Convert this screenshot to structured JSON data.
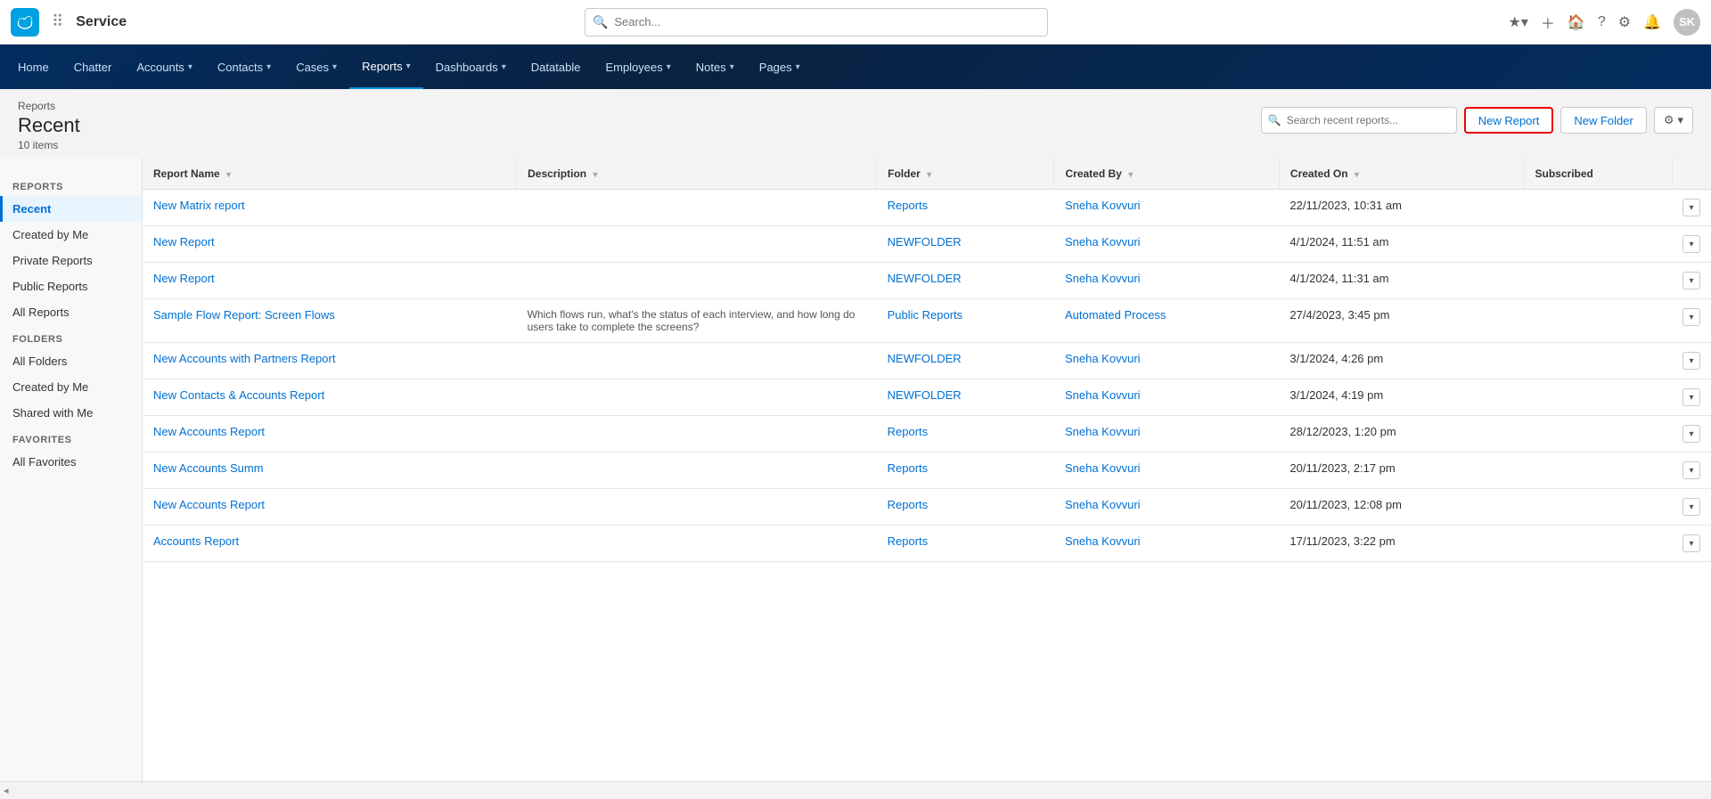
{
  "topNav": {
    "appName": "Service",
    "searchPlaceholder": "Search...",
    "navItems": [
      {
        "label": "Home",
        "hasDropdown": false
      },
      {
        "label": "Chatter",
        "hasDropdown": false
      },
      {
        "label": "Accounts",
        "hasDropdown": true
      },
      {
        "label": "Contacts",
        "hasDropdown": true
      },
      {
        "label": "Cases",
        "hasDropdown": true
      },
      {
        "label": "Reports",
        "hasDropdown": true,
        "active": true
      },
      {
        "label": "Dashboards",
        "hasDropdown": true
      },
      {
        "label": "Datatable",
        "hasDropdown": false
      },
      {
        "label": "Employees",
        "hasDropdown": true
      },
      {
        "label": "Notes",
        "hasDropdown": true
      },
      {
        "label": "Pages",
        "hasDropdown": true
      }
    ]
  },
  "pageHeader": {
    "breadcrumb": "Reports",
    "title": "Recent",
    "itemCount": "10 items",
    "searchPlaceholder": "Search recent reports...",
    "newReportLabel": "New Report",
    "newFolderLabel": "New Folder"
  },
  "sidebar": {
    "reportsSection": "REPORTS",
    "reportItems": [
      {
        "label": "Recent",
        "active": true
      },
      {
        "label": "Created by Me",
        "active": false
      },
      {
        "label": "Private Reports",
        "active": false
      },
      {
        "label": "Public Reports",
        "active": false
      },
      {
        "label": "All Reports",
        "active": false
      }
    ],
    "foldersSection": "FOLDERS",
    "folderItems": [
      {
        "label": "All Folders",
        "active": false
      },
      {
        "label": "Created by Me",
        "active": false
      },
      {
        "label": "Shared with Me",
        "active": false
      }
    ],
    "favoritesSection": "FAVORITES",
    "favoriteItems": [
      {
        "label": "All Favorites",
        "active": false
      }
    ]
  },
  "table": {
    "columns": [
      {
        "label": "Report Name",
        "sortable": true
      },
      {
        "label": "Description",
        "sortable": true
      },
      {
        "label": "Folder",
        "sortable": true
      },
      {
        "label": "Created By",
        "sortable": true
      },
      {
        "label": "Created On",
        "sortable": true
      },
      {
        "label": "Subscribed",
        "sortable": false
      }
    ],
    "rows": [
      {
        "reportName": "New Matrix report",
        "description": "",
        "folder": "Reports",
        "createdBy": "Sneha Kovvuri",
        "createdOn": "22/11/2023, 10:31 am",
        "subscribed": ""
      },
      {
        "reportName": "New Report",
        "description": "",
        "folder": "NEWFOLDER",
        "createdBy": "Sneha Kovvuri",
        "createdOn": "4/1/2024, 11:51 am",
        "subscribed": ""
      },
      {
        "reportName": "New Report",
        "description": "",
        "folder": "NEWFOLDER",
        "createdBy": "Sneha Kovvuri",
        "createdOn": "4/1/2024, 11:31 am",
        "subscribed": ""
      },
      {
        "reportName": "Sample Flow Report: Screen Flows",
        "description": "Which flows run, what's the status of each interview, and how long do users take to complete the screens?",
        "folder": "Public Reports",
        "createdBy": "Automated Process",
        "createdOn": "27/4/2023, 3:45 pm",
        "subscribed": ""
      },
      {
        "reportName": "New Accounts with Partners Report",
        "description": "",
        "folder": "NEWFOLDER",
        "createdBy": "Sneha Kovvuri",
        "createdOn": "3/1/2024, 4:26 pm",
        "subscribed": ""
      },
      {
        "reportName": "New Contacts & Accounts Report",
        "description": "",
        "folder": "NEWFOLDER",
        "createdBy": "Sneha Kovvuri",
        "createdOn": "3/1/2024, 4:19 pm",
        "subscribed": ""
      },
      {
        "reportName": "New Accounts Report",
        "description": "",
        "folder": "Reports",
        "createdBy": "Sneha Kovvuri",
        "createdOn": "28/12/2023, 1:20 pm",
        "subscribed": ""
      },
      {
        "reportName": "New Accounts Summ",
        "description": "",
        "folder": "Reports",
        "createdBy": "Sneha Kovvuri",
        "createdOn": "20/11/2023, 2:17 pm",
        "subscribed": ""
      },
      {
        "reportName": "New Accounts Report",
        "description": "",
        "folder": "Reports",
        "createdBy": "Sneha Kovvuri",
        "createdOn": "20/11/2023, 12:08 pm",
        "subscribed": ""
      },
      {
        "reportName": "Accounts Report",
        "description": "",
        "folder": "Reports",
        "createdBy": "Sneha Kovvuri",
        "createdOn": "17/11/2023, 3:22 pm",
        "subscribed": ""
      }
    ]
  }
}
